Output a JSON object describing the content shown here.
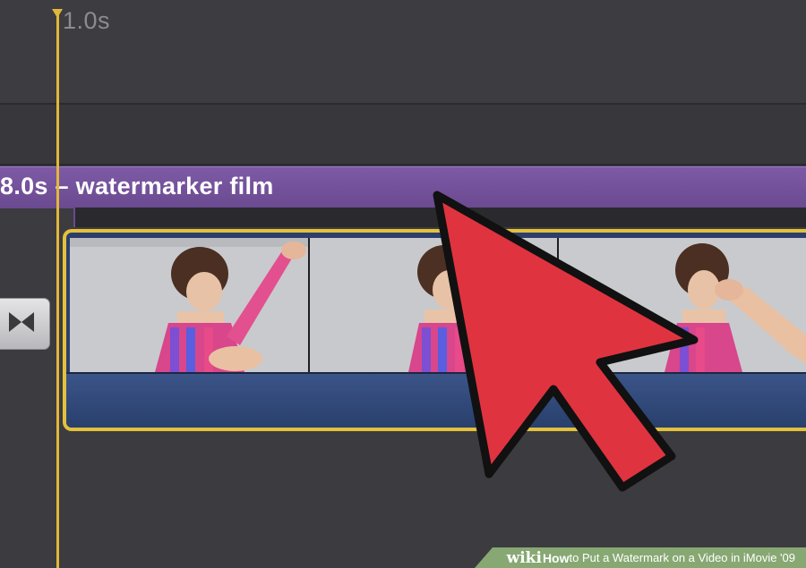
{
  "timeline": {
    "ruler_label": "1.0s",
    "title_clip_label": "8.0s – watermarker film"
  },
  "clip": {
    "frames": [
      "frame-1",
      "frame-2",
      "frame-3"
    ]
  },
  "colors": {
    "playhead": "#e2b73a",
    "title_bar": "#7e5aa6",
    "clip_border": "#e3c13c",
    "audio_track": "#2c3f6b",
    "cursor": "#e03340"
  },
  "icons": {
    "transition": "bowtie-transition-icon",
    "cursor": "arrow-cursor-icon"
  },
  "watermark": {
    "brand": "wiki",
    "how": "How",
    "rest": " to Put a Watermark on a Video in iMovie '09"
  }
}
